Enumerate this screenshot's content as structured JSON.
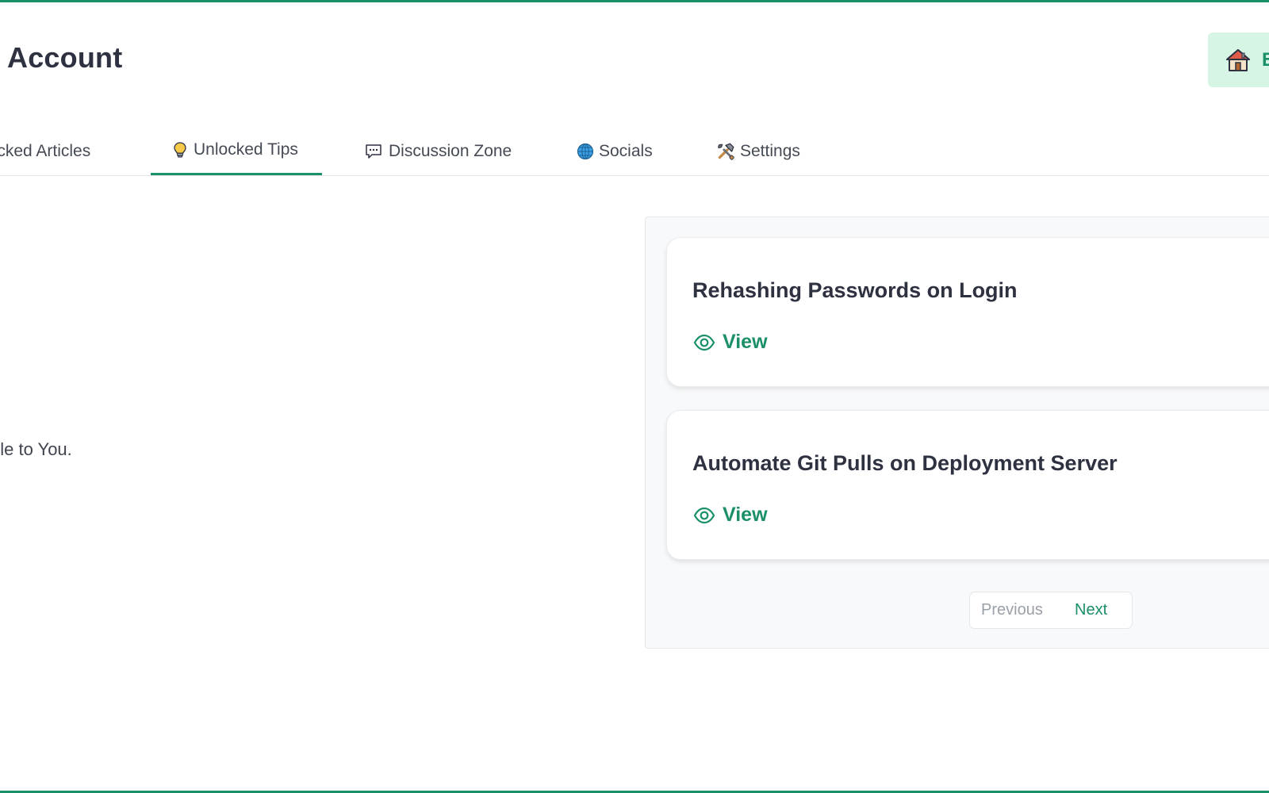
{
  "header": {
    "title": "Account",
    "back_button_label": "B"
  },
  "tabs": [
    {
      "label": "locked Articles",
      "icon": "unlocked-articles-icon",
      "active": false
    },
    {
      "label": "Unlocked Tips",
      "icon": "lightbulb-icon",
      "active": true
    },
    {
      "label": "Discussion Zone",
      "icon": "speech-bubble-icon",
      "active": false
    },
    {
      "label": "Socials",
      "icon": "globe-icon",
      "active": false
    },
    {
      "label": "Settings",
      "icon": "tools-icon",
      "active": false
    }
  ],
  "left_panel": {
    "message": "ble to You."
  },
  "tips": [
    {
      "title": "Rehashing Passwords on Login",
      "action_label": "View",
      "icon": "eye-icon"
    },
    {
      "title": "Automate Git Pulls on Deployment Server",
      "action_label": "View",
      "icon": "eye-icon"
    }
  ],
  "pagination": {
    "previous_label": "Previous",
    "next_label": "Next",
    "previous_disabled": true
  },
  "colors": {
    "accent": "#1a8f68",
    "accent_light": "#d6f5e4",
    "text_dark": "#2d3140",
    "panel_bg": "#f8f9fa",
    "border": "#e3e6ea",
    "disabled": "#9aa0a8"
  }
}
